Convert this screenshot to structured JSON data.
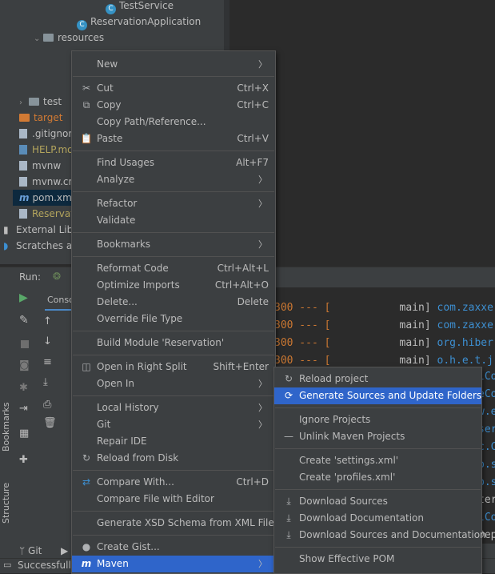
{
  "tree": {
    "items": [
      {
        "label": "TestService",
        "icon": "class-icon"
      },
      {
        "label": "ReservationApplication",
        "icon": "spring-class-icon"
      },
      {
        "label": "resources",
        "icon": "folder-icon"
      },
      {
        "label": "test",
        "icon": "folder-icon"
      },
      {
        "label": "target",
        "icon": "folder-orange-icon"
      },
      {
        "label": ".gitignor",
        "icon": "file-icon"
      },
      {
        "label": "HELP.mo",
        "icon": "markdown-icon"
      },
      {
        "label": "mvnw",
        "icon": "file-icon"
      },
      {
        "label": "mvnw.cr",
        "icon": "file-icon"
      },
      {
        "label": "pom.xm",
        "icon": "maven-icon"
      },
      {
        "label": "Reservati",
        "icon": "file-icon"
      },
      {
        "label": "External Libr",
        "icon": "library-icon"
      },
      {
        "label": "Scratches an",
        "icon": "scratch-icon"
      }
    ]
  },
  "run": {
    "label": "Run:",
    "tab": "Conso",
    "log_prefix": [
      "300 --- [",
      "300 --- [",
      "300 --- [",
      "300 --- ["
    ],
    "log_thread": [
      "main]",
      "main]",
      "main]",
      "main]"
    ],
    "log_logger": [
      "com.zaxxe",
      "com.zaxxe",
      "org.hiber",
      "o.h.e.t.j"
    ],
    "right_fragments": [
      "lCo",
      "eCo",
      "w.e",
      "ser",
      "c.C",
      "b.s",
      "b.s",
      "ter",
      "lCo",
      "Depe"
    ]
  },
  "bottom": {
    "git": "Git",
    "status": "Successfully"
  },
  "side_tabs": {
    "bookmarks": "Bookmarks",
    "structure": "Structure"
  },
  "context_menu": {
    "items": [
      {
        "label": "New",
        "submenu": true
      },
      {
        "sep": true
      },
      {
        "label": "Cut",
        "shortcut": "Ctrl+X",
        "icon": "cut-icon"
      },
      {
        "label": "Copy",
        "shortcut": "Ctrl+C",
        "icon": "copy-icon"
      },
      {
        "label": "Copy Path/Reference..."
      },
      {
        "label": "Paste",
        "shortcut": "Ctrl+V",
        "icon": "paste-icon"
      },
      {
        "sep": true
      },
      {
        "label": "Find Usages",
        "shortcut": "Alt+F7"
      },
      {
        "label": "Analyze",
        "submenu": true
      },
      {
        "sep": true
      },
      {
        "label": "Refactor",
        "submenu": true
      },
      {
        "label": "Validate"
      },
      {
        "sep": true
      },
      {
        "label": "Bookmarks",
        "submenu": true
      },
      {
        "sep": true
      },
      {
        "label": "Reformat Code",
        "shortcut": "Ctrl+Alt+L"
      },
      {
        "label": "Optimize Imports",
        "shortcut": "Ctrl+Alt+O"
      },
      {
        "label": "Delete...",
        "shortcut": "Delete"
      },
      {
        "label": "Override File Type"
      },
      {
        "sep": true
      },
      {
        "label": "Build Module 'Reservation'"
      },
      {
        "sep": true
      },
      {
        "label": "Open in Right Split",
        "shortcut": "Shift+Enter",
        "icon": "split-icon"
      },
      {
        "label": "Open In",
        "submenu": true
      },
      {
        "sep": true
      },
      {
        "label": "Local History",
        "submenu": true
      },
      {
        "label": "Git",
        "submenu": true
      },
      {
        "label": "Repair IDE"
      },
      {
        "label": "Reload from Disk",
        "icon": "reload-icon"
      },
      {
        "sep": true
      },
      {
        "label": "Compare With...",
        "shortcut": "Ctrl+D",
        "icon": "compare-icon"
      },
      {
        "label": "Compare File with Editor"
      },
      {
        "sep": true
      },
      {
        "label": "Generate XSD Schema from XML File..."
      },
      {
        "sep": true
      },
      {
        "label": "Create Gist...",
        "icon": "github-icon"
      },
      {
        "label": "Maven",
        "submenu": true,
        "icon": "maven-icon",
        "selected": true
      }
    ]
  },
  "maven_menu": {
    "items": [
      {
        "label": "Reload project",
        "icon": "reload-icon"
      },
      {
        "label": "Generate Sources and Update Folders",
        "icon": "generate-icon",
        "selected": true
      },
      {
        "sep": true
      },
      {
        "label": "Ignore Projects"
      },
      {
        "label": "Unlink Maven Projects",
        "icon": "minus-icon"
      },
      {
        "sep": true
      },
      {
        "label": "Create 'settings.xml'"
      },
      {
        "label": "Create 'profiles.xml'"
      },
      {
        "sep": true
      },
      {
        "label": "Download Sources",
        "icon": "download-icon"
      },
      {
        "label": "Download Documentation",
        "icon": "download-icon"
      },
      {
        "label": "Download Sources and Documentation",
        "icon": "download-icon"
      },
      {
        "sep": true
      },
      {
        "label": "Show Effective POM"
      }
    ]
  },
  "colors": {
    "selection": "#2f65ca",
    "menu_bg": "#3c3f41",
    "editor_bg": "#2b2b2b",
    "log_blue": "#3d8fd1"
  }
}
